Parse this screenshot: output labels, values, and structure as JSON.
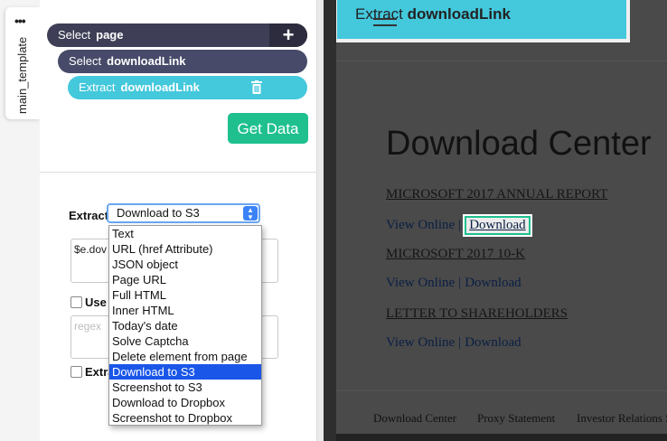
{
  "sidebar": {
    "tab_label": "main_template",
    "menu_icon": "dots-icon"
  },
  "steps": {
    "select_page": {
      "verb": "Select",
      "target": "page"
    },
    "select_link": {
      "verb": "Select",
      "target": "downloadLink"
    },
    "extract_link": {
      "verb": "Extract",
      "target": "downloadLink"
    },
    "add_icon": "plus-icon",
    "delete_icon": "trash-icon"
  },
  "get_data_label": "Get Data",
  "extract": {
    "label": "Extract",
    "selected": "Download to S3",
    "options": [
      "Text",
      "URL (href Attribute)",
      "JSON object",
      "Page URL",
      "Full HTML",
      "Inner HTML",
      "Today's date",
      "Solve Captcha",
      "Delete element from page",
      "Download to S3",
      "Screenshot to S3",
      "Download to Dropbox",
      "Screenshot to Dropbox"
    ],
    "selected_index": 9
  },
  "code_field_value": "$e.dov",
  "use_label": "Use",
  "regex_placeholder": "regex",
  "extra_label": "Extra",
  "website": {
    "tooltip_verb": "Extract",
    "tooltip_target": "downloadLink",
    "heading": "Download Center",
    "documents": [
      {
        "title": "MICROSOFT 2017 ANNUAL REPORT",
        "view": "View Online",
        "download": "Download"
      },
      {
        "title": "MICROSOFT 2017 10-K",
        "view": "View Online",
        "download": "Download"
      },
      {
        "title": "LETTER TO SHAREHOLDERS",
        "view": "View Online",
        "download": "Download"
      }
    ],
    "separator": "|",
    "footer": [
      "Download Center",
      "Proxy Statement",
      "Investor Relations S"
    ]
  },
  "colors": {
    "accent": "#44c8dc",
    "primary_btn": "#1fc08e",
    "step_dark": "#3e3e56"
  }
}
